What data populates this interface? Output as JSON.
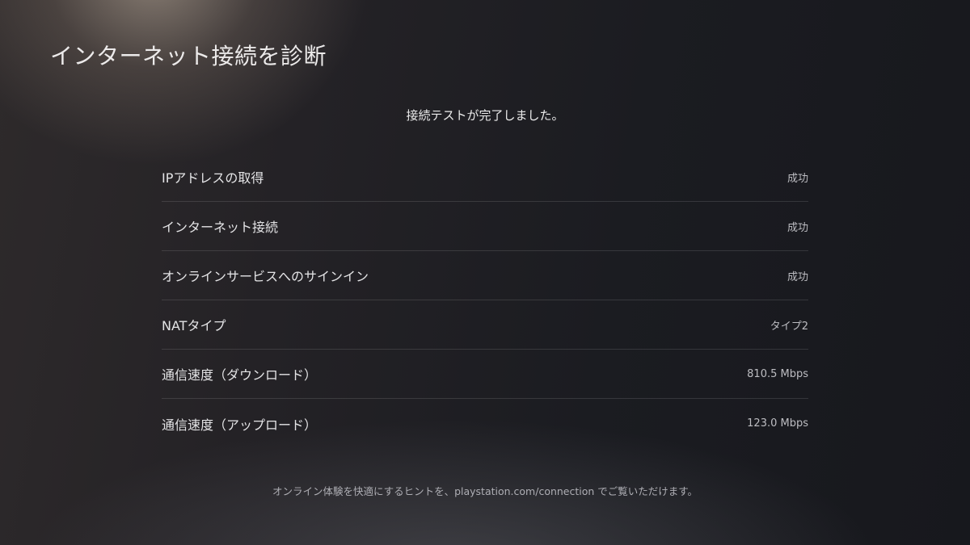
{
  "page": {
    "title": "インターネット接続を診断",
    "status_message": "接続テストが完了しました。"
  },
  "results": [
    {
      "label": "IPアドレスの取得",
      "value": "成功"
    },
    {
      "label": "インターネット接続",
      "value": "成功"
    },
    {
      "label": "オンラインサービスへのサインイン",
      "value": "成功"
    },
    {
      "label": "NATタイプ",
      "value": "タイプ2"
    },
    {
      "label": "通信速度（ダウンロード）",
      "value": "810.5 Mbps"
    },
    {
      "label": "通信速度（アップロード）",
      "value": "123.0 Mbps"
    }
  ],
  "footer": {
    "hint": "オンライン体験を快適にするヒントを、playstation.com/connection でご覧いただけます。"
  }
}
